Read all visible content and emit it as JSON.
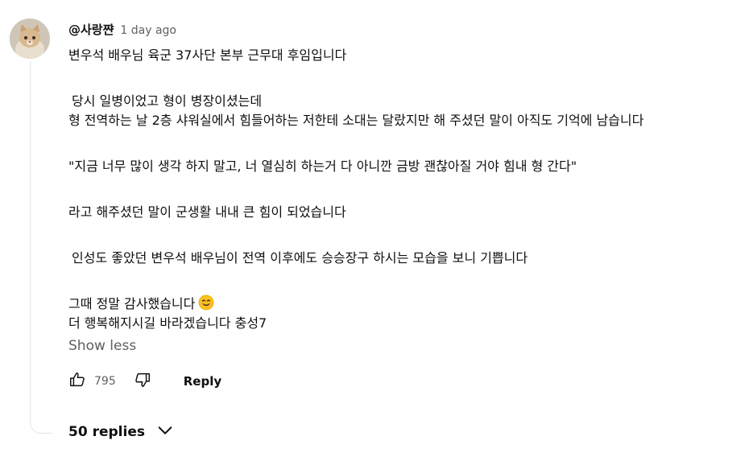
{
  "comment": {
    "author": "@사랑쨘",
    "time": "1 day ago",
    "lines": {
      "l1": "변우석 배우님 육군 37사단 본부 근무대 후임입니다",
      "l2": "당시 일병이었고 형이 병장이셨는데",
      "l3": "형 전역하는 날 2층 샤워실에서 힘들어하는 저한테 소대는 달랐지만 해 주셨던 말이 아직도 기억에 남습니다",
      "l4": "\"지금 너무 많이 생각 하지 말고, 너 열심히 하는거 다 아니깐 금방 괜찮아질 거야 힘내 형 간다\"",
      "l5": "라고 해주셨던 말이 군생활 내내 큰 힘이 되었습니다",
      "l6": "인성도 좋았던 변우석 배우님이 전역 이후에도 승승장구 하시는 모습을 보니 기쁩니다",
      "l7": "그때 정말 감사했습니다",
      "l8": "더 행복해지시길 바라겠습니다 충성7"
    },
    "emoji": "smiling-face-emoji",
    "show_less": "Show less",
    "like_count": "795",
    "reply_label": "Reply",
    "replies_label": "50 replies",
    "icons": {
      "like": "thumbs-up-icon",
      "dislike": "thumbs-down-icon",
      "expand": "chevron-down-icon"
    }
  }
}
